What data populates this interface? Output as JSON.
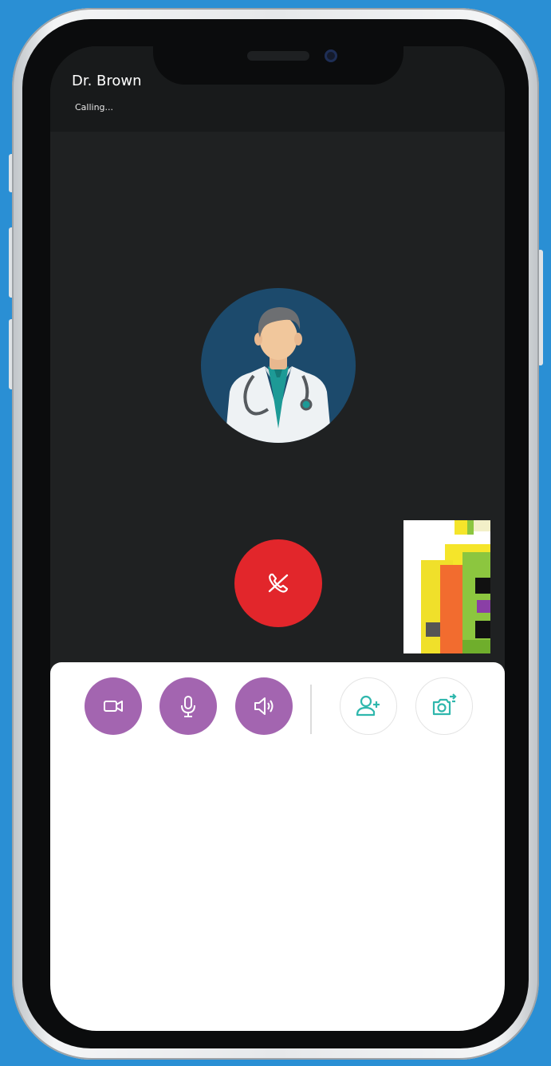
{
  "call": {
    "caller_name": "Dr. Brown",
    "status": "Calling..."
  },
  "colors": {
    "background": "#2a8fd4",
    "screen": "#1f2122",
    "hangup": "#e2262b",
    "control_purple": "#a365b0",
    "control_teal": "#2fb7ad"
  },
  "controls": {
    "left": [
      {
        "icon": "video-camera-icon"
      },
      {
        "icon": "microphone-icon"
      },
      {
        "icon": "speaker-icon"
      }
    ],
    "right": [
      {
        "icon": "add-user-icon"
      },
      {
        "icon": "switch-camera-icon"
      }
    ],
    "end_call": {
      "icon": "end-call-icon"
    }
  }
}
